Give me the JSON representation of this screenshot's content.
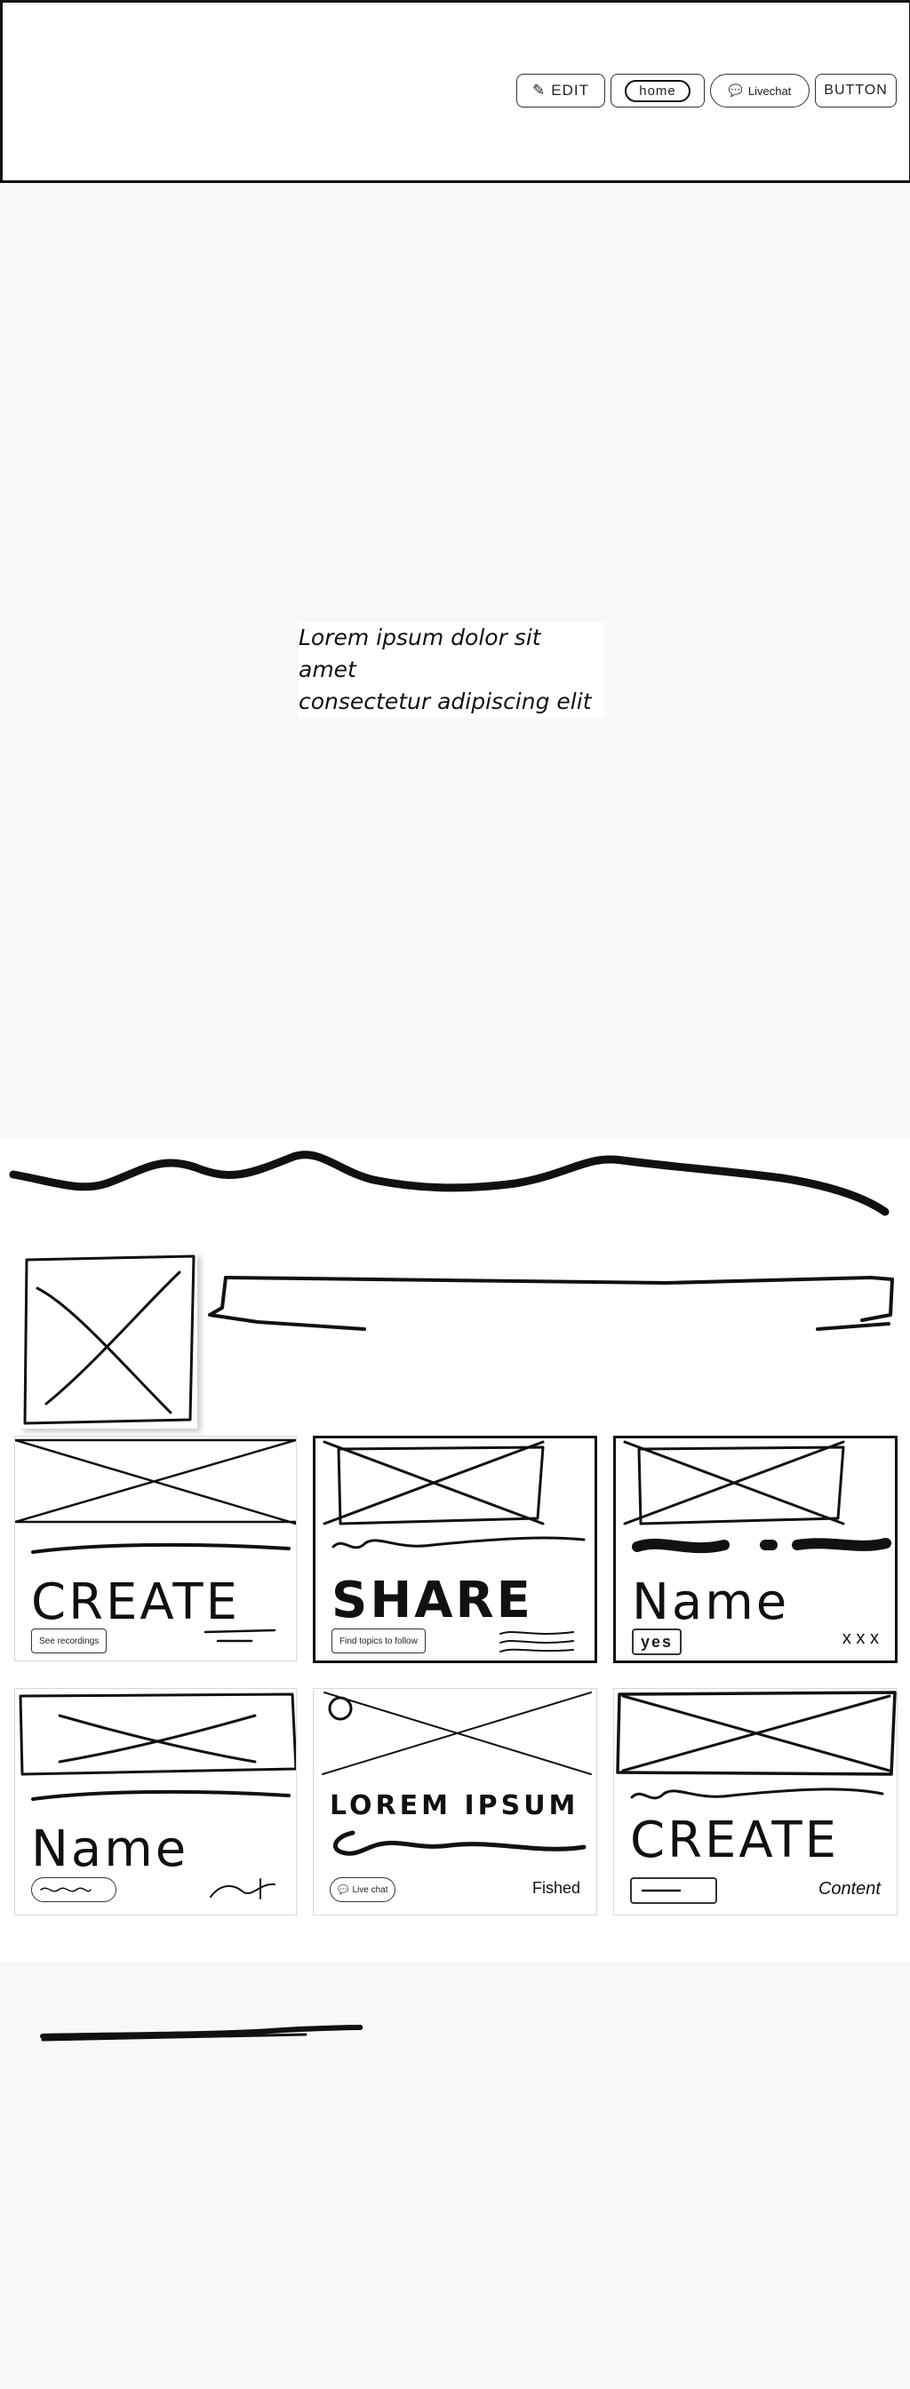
{
  "header": {
    "nav": {
      "edit_label": "EDIT",
      "home_label": "home",
      "livechat_label": "Livechat",
      "button_label": "BUTTON"
    }
  },
  "hero": {
    "text_line1": "Lorem ipsum dolor sit amet",
    "text_line2": "consectetur adipiscing elit"
  },
  "cards": [
    {
      "title": "CREATE",
      "button": "See recordings"
    },
    {
      "title": "SHARE",
      "button": "Find topics to follow"
    },
    {
      "title": "Name",
      "button": "yes",
      "meta": "x x x"
    },
    {
      "title": "Name"
    },
    {
      "title": "LOREM IPSUM",
      "button": "Live chat",
      "meta": "Fished"
    },
    {
      "title": "CREATE",
      "meta": "Content"
    }
  ],
  "colors": {
    "ink": "#111111",
    "background": "#f9f9f9",
    "card_border": "#d8d8d8"
  }
}
